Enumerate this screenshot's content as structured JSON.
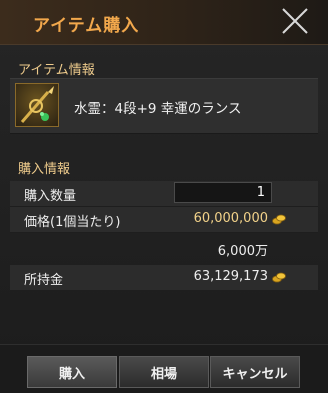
{
  "window": {
    "title": "アイテム購入"
  },
  "item_info": {
    "section_label": "アイテム情報",
    "icon": "lance-item-icon",
    "name": "水霊：4段+9 幸運のランス"
  },
  "purchase_info": {
    "section_label": "購入情報",
    "quantity_label": "購入数量",
    "quantity_value": "1",
    "price_label": "価格(1個当たり)",
    "price_value": "60,000,000",
    "price_short": "6,000万",
    "balance_label": "所持金",
    "balance_value": "63,129,173",
    "currency_icon": "gold-coin-icon"
  },
  "footer": {
    "buy_label": "購入",
    "market_label": "相場",
    "cancel_label": "キャンセル"
  },
  "colors": {
    "title": "#f2a84c",
    "section": "#eecb8c",
    "price": "#f2d28a"
  }
}
